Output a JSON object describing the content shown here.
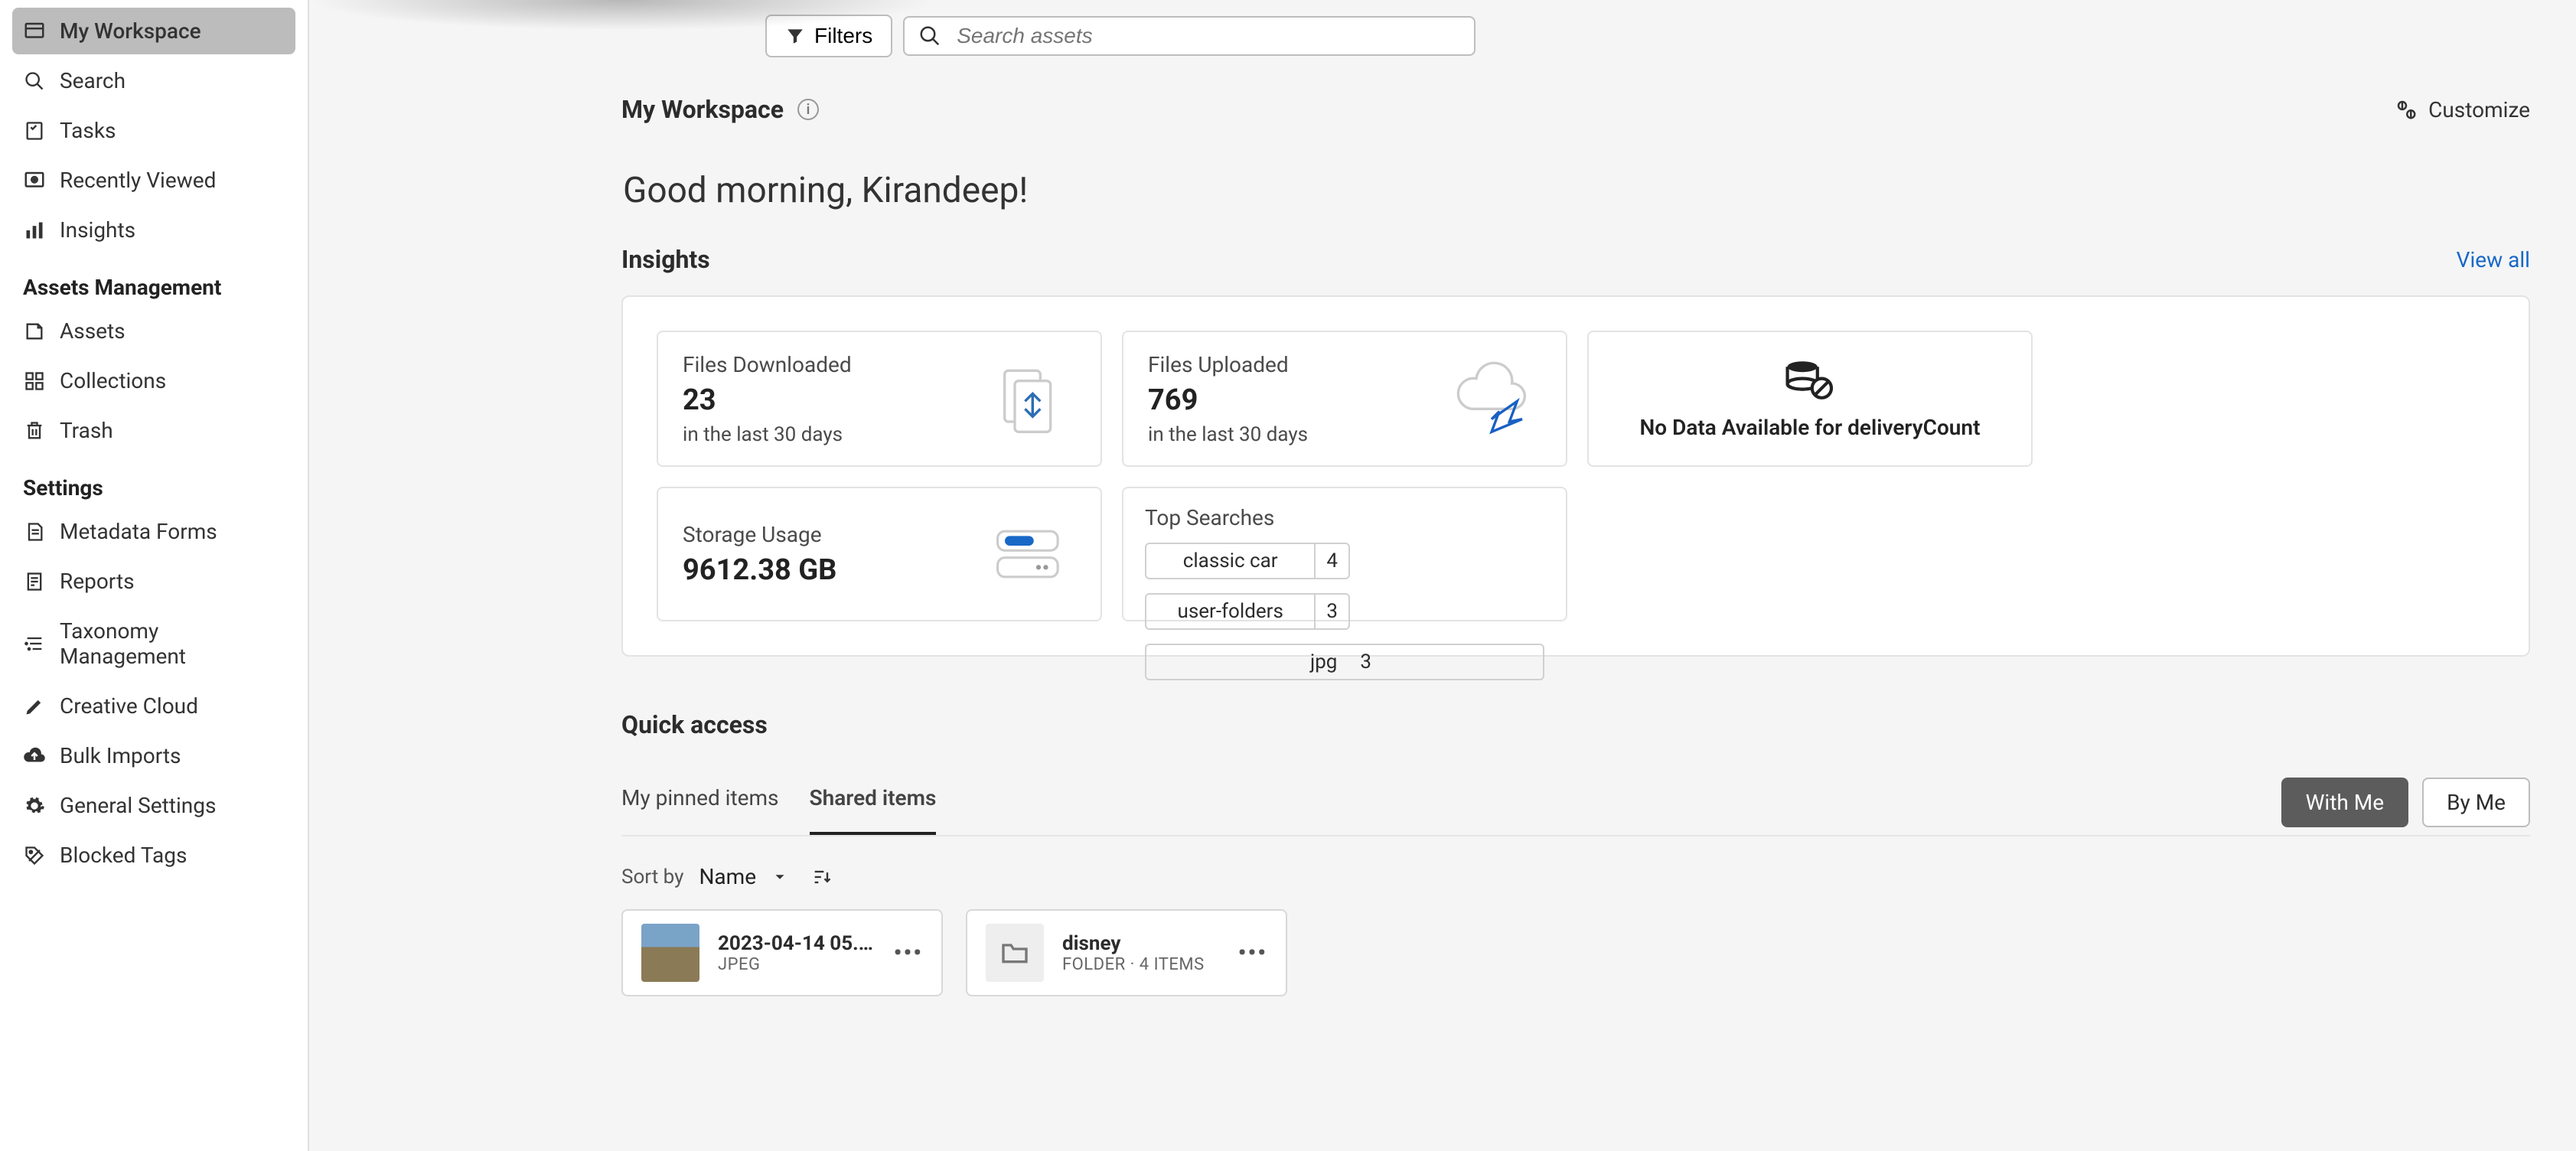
{
  "sidebar": {
    "main": [
      {
        "label": "My Workspace",
        "icon": "workspace"
      },
      {
        "label": "Search",
        "icon": "search"
      },
      {
        "label": "Tasks",
        "icon": "tasks"
      },
      {
        "label": "Recently Viewed",
        "icon": "recent"
      },
      {
        "label": "Insights",
        "icon": "insights"
      }
    ],
    "section_assets": "Assets Management",
    "assets": [
      {
        "label": "Assets",
        "icon": "assets"
      },
      {
        "label": "Collections",
        "icon": "collections"
      },
      {
        "label": "Trash",
        "icon": "trash"
      }
    ],
    "section_settings": "Settings",
    "settings": [
      {
        "label": "Metadata Forms",
        "icon": "metadata"
      },
      {
        "label": "Reports",
        "icon": "reports"
      },
      {
        "label": "Taxonomy Management",
        "icon": "taxonomy"
      },
      {
        "label": "Creative Cloud",
        "icon": "brush"
      },
      {
        "label": "Bulk Imports",
        "icon": "cloud-up"
      },
      {
        "label": "General Settings",
        "icon": "gear"
      },
      {
        "label": "Blocked Tags",
        "icon": "blocked"
      }
    ]
  },
  "topbar": {
    "filters_label": "Filters",
    "search_placeholder": "Search assets"
  },
  "header": {
    "title": "My Workspace",
    "customize": "Customize",
    "greeting": "Good morning, Kirandeep!"
  },
  "insights": {
    "title": "Insights",
    "view_all": "View all",
    "downloads": {
      "label": "Files Downloaded",
      "value": "23",
      "sub": "in the last 30 days"
    },
    "uploads": {
      "label": "Files Uploaded",
      "value": "769",
      "sub": "in the last 30 days"
    },
    "empty": {
      "msg": "No Data Available for deliveryCount"
    },
    "storage": {
      "label": "Storage Usage",
      "value": "9612.38 GB"
    },
    "top_searches": {
      "label": "Top Searches",
      "items": [
        {
          "term": "classic car",
          "count": "4"
        },
        {
          "term": "user-folders",
          "count": "3"
        },
        {
          "term": "jpg",
          "count": "3"
        }
      ]
    }
  },
  "quick": {
    "title": "Quick access",
    "tabs": {
      "pinned": "My pinned items",
      "shared": "Shared items"
    },
    "seg": {
      "with_me": "With Me",
      "by_me": "By Me"
    },
    "sort": {
      "label": "Sort by",
      "value": "Name"
    },
    "items": [
      {
        "name": "2023-04-14 05.1…",
        "sub": "JPEG",
        "type": "image"
      },
      {
        "name": "disney",
        "sub": "FOLDER · 4 ITEMS",
        "type": "folder"
      }
    ]
  }
}
